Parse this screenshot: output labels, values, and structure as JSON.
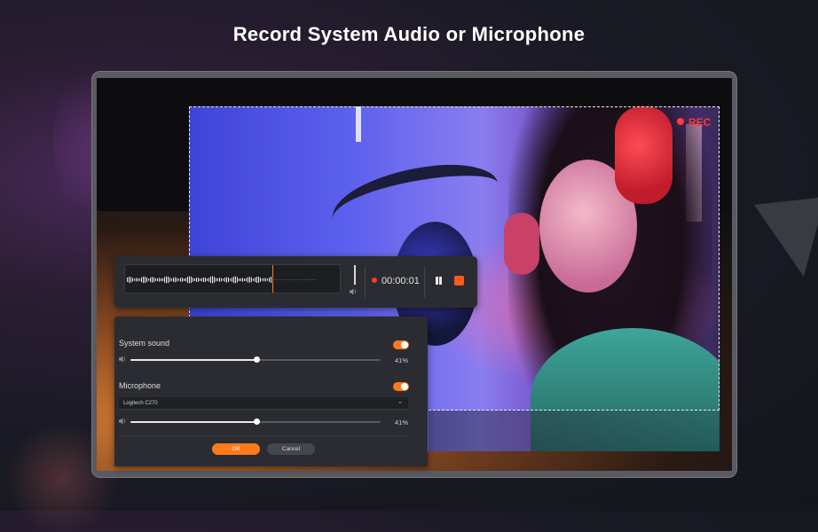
{
  "headline": "Record System Audio or Microphone",
  "recording": {
    "rec_label": "REC",
    "timer": "00:00:01",
    "waveform_progress": 0.68
  },
  "audio_panel": {
    "system_sound": {
      "label": "System sound",
      "enabled": true,
      "volume_percent": 41,
      "volume_label": "41%"
    },
    "microphone": {
      "label": "Microphone",
      "enabled": true,
      "device": "Logitech C270",
      "volume_percent": 41,
      "volume_label": "41%"
    },
    "ok_label": "OK",
    "cancel_label": "Cancel"
  },
  "icons": {
    "speaker": "speaker-icon",
    "pause": "pause-icon",
    "stop": "stop-icon",
    "chevron": "chevron-down-icon"
  },
  "colors": {
    "accent": "#ff7a1a",
    "record_red": "#ff3b3b",
    "panel_bg": "#2b2c31"
  }
}
